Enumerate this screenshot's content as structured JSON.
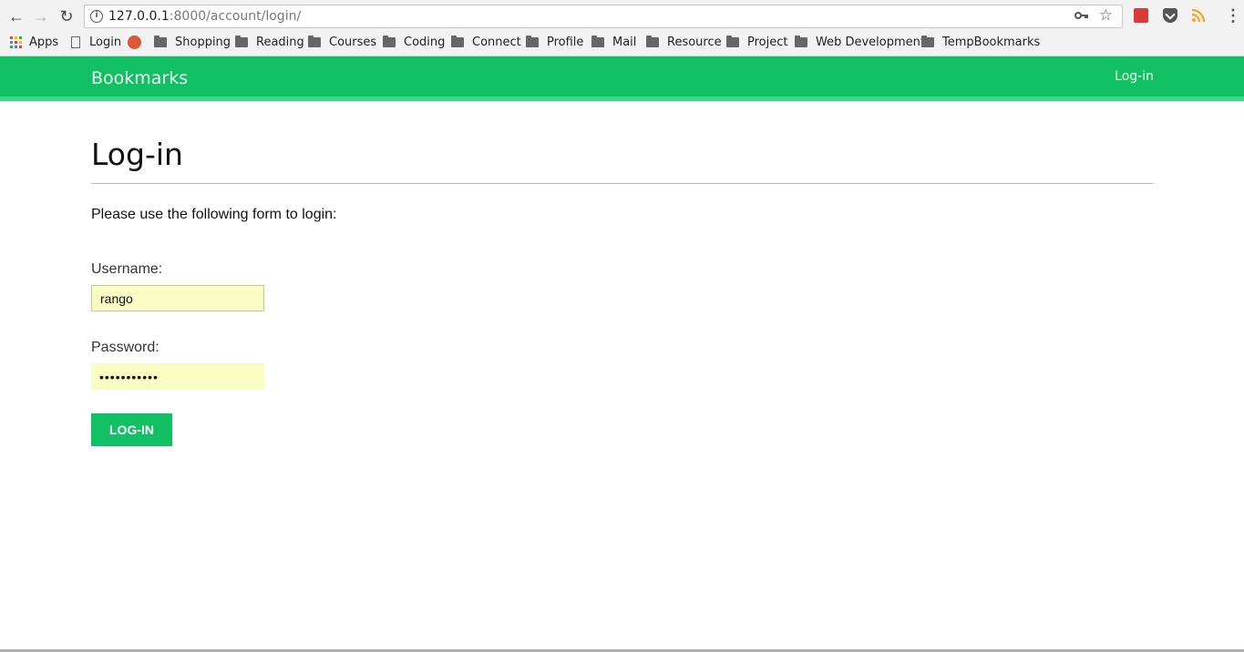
{
  "browser": {
    "url_host": "127.0.0.1",
    "url_rest": ":8000/account/login/",
    "back_icon": "←",
    "forward_icon": "→",
    "reload_icon": "↻",
    "key_icon": "key",
    "star_icon": "☆",
    "menu_icon": "⋮"
  },
  "bookmarks": [
    {
      "label": "Apps",
      "icon": "apps-grid-icon"
    },
    {
      "label": "Login",
      "icon": "page-icon"
    },
    {
      "label": "Shopping",
      "icon": "folder-icon"
    },
    {
      "label": "Reading",
      "icon": "folder-icon"
    },
    {
      "label": "Courses",
      "icon": "folder-icon"
    },
    {
      "label": "Coding",
      "icon": "folder-icon"
    },
    {
      "label": "Connect",
      "icon": "folder-icon"
    },
    {
      "label": "Profile",
      "icon": "folder-icon"
    },
    {
      "label": "Mail",
      "icon": "folder-icon"
    },
    {
      "label": "Resource",
      "icon": "folder-icon"
    },
    {
      "label": "Project",
      "icon": "folder-icon"
    },
    {
      "label": "Web Development",
      "icon": "folder-icon"
    },
    {
      "label": "TempBookmarks",
      "icon": "folder-icon"
    }
  ],
  "header": {
    "brand": "Bookmarks",
    "login_link": "Log-in",
    "color": "#12c064"
  },
  "main": {
    "title": "Log-in",
    "intro": "Please use the following form to login:",
    "username_label": "Username:",
    "username_value": "rango",
    "password_label": "Password:",
    "password_value": "•••••••••••",
    "submit_label": "LOG-IN"
  }
}
